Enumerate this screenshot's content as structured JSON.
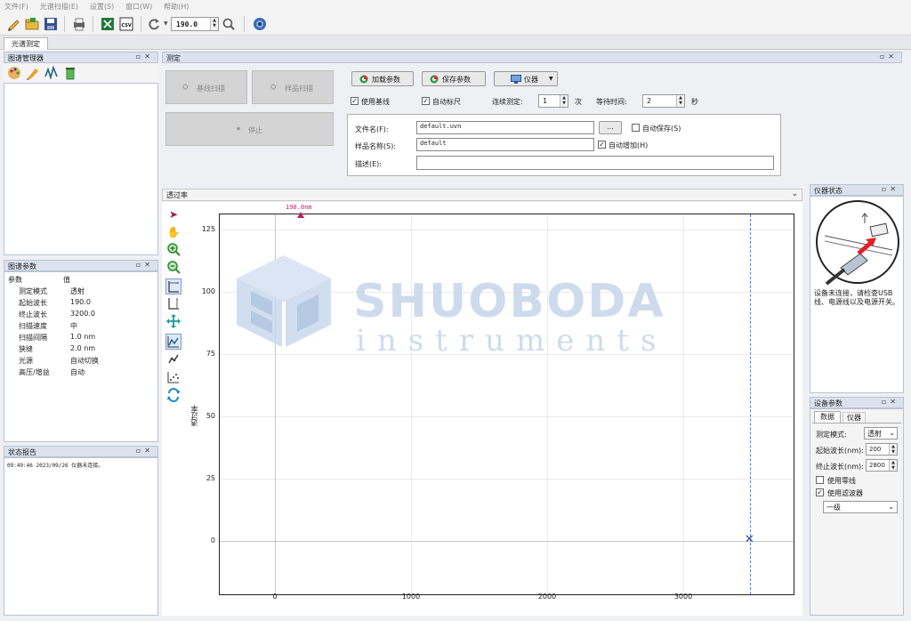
{
  "menu": [
    "文件(F)",
    "光谱扫描(E)",
    "设置(S)",
    "窗口(W)",
    "帮助(H)"
  ],
  "toolbar": {
    "wavelength_value": "190.0"
  },
  "doc_tab": "光谱测定",
  "spectrum_manager": {
    "title": "图谱管理器"
  },
  "spectrum_params": {
    "title": "图谱参数",
    "header": [
      "参数",
      "值"
    ],
    "rows": [
      [
        "测定模式",
        "透射"
      ],
      [
        "起始波长",
        "190.0"
      ],
      [
        "终止波长",
        "3200.0"
      ],
      [
        "扫描速度",
        "中"
      ],
      [
        "扫描间隔",
        "1.0 nm"
      ],
      [
        "狭缝",
        "2.0 nm"
      ],
      [
        "光源",
        "自动切换"
      ],
      [
        "高压/增益",
        "自动"
      ]
    ]
  },
  "status_report": {
    "title": "状态报告",
    "log": "09:49:46 2023/09/26 仪器未连接。"
  },
  "measure": {
    "title": "测定",
    "baseline_scan": "基线扫描",
    "sample_scan": "样品扫描",
    "stop": "停止",
    "load_params": "加载参数",
    "save_params": "保存参数",
    "instrument": "仪器",
    "use_baseline": "使用基线",
    "auto_scale": "自动标尺",
    "continuous_label": "连续测定:",
    "continuous_value": "1",
    "continuous_unit": "次",
    "wait_label": "等待时间:",
    "wait_value": "2",
    "wait_unit": "秒",
    "filename_label": "文件名(F):",
    "filename_value": "default.uvn",
    "browse": "...",
    "auto_save": "自动保存(S)",
    "sample_name_label": "样品名称(S):",
    "sample_name_value": "default",
    "auto_increment": "自动增加(H)",
    "description_label": "描述(E):",
    "description_value": ""
  },
  "plot": {
    "title": "透过率",
    "ylabel": "透过率",
    "marker_label": "190.0nm",
    "watermark_main": "SHUOBODA",
    "watermark_sub": "instruments"
  },
  "chart_data": {
    "type": "line",
    "ylabel": "透过率",
    "xlim": [
      -400,
      3800
    ],
    "ylim": [
      -22,
      132
    ],
    "x_ticks": [
      0,
      1000,
      2000,
      3000
    ],
    "y_ticks": [
      0,
      25,
      50,
      75,
      100,
      125
    ],
    "series": [],
    "marker": {
      "x": 190,
      "label": "190.0nm"
    },
    "cursor_x": 3500,
    "cross_point": {
      "x": 3500,
      "y": 0
    },
    "grid": true
  },
  "instrument_status": {
    "title": "仪器状态",
    "message": "设备未连接，请检查USB线、电源线以及电源开关。"
  },
  "device_params": {
    "title": "设备参数",
    "tabs": [
      "数据",
      "仪器"
    ],
    "mode_label": "测定模式:",
    "mode_value": "透射",
    "start_label": "起始波长(nm):",
    "start_value": "200",
    "end_label": "终止波长(nm):",
    "end_value": "2800",
    "use_zero": "使用零线",
    "use_filter": "使用滤波器",
    "filter_value": "一级"
  },
  "colors": {
    "panel_header": "#dbe2ee",
    "marker": "#c0206a",
    "cursor": "#5a7fd4",
    "usb_arrow": "#e0202a"
  }
}
